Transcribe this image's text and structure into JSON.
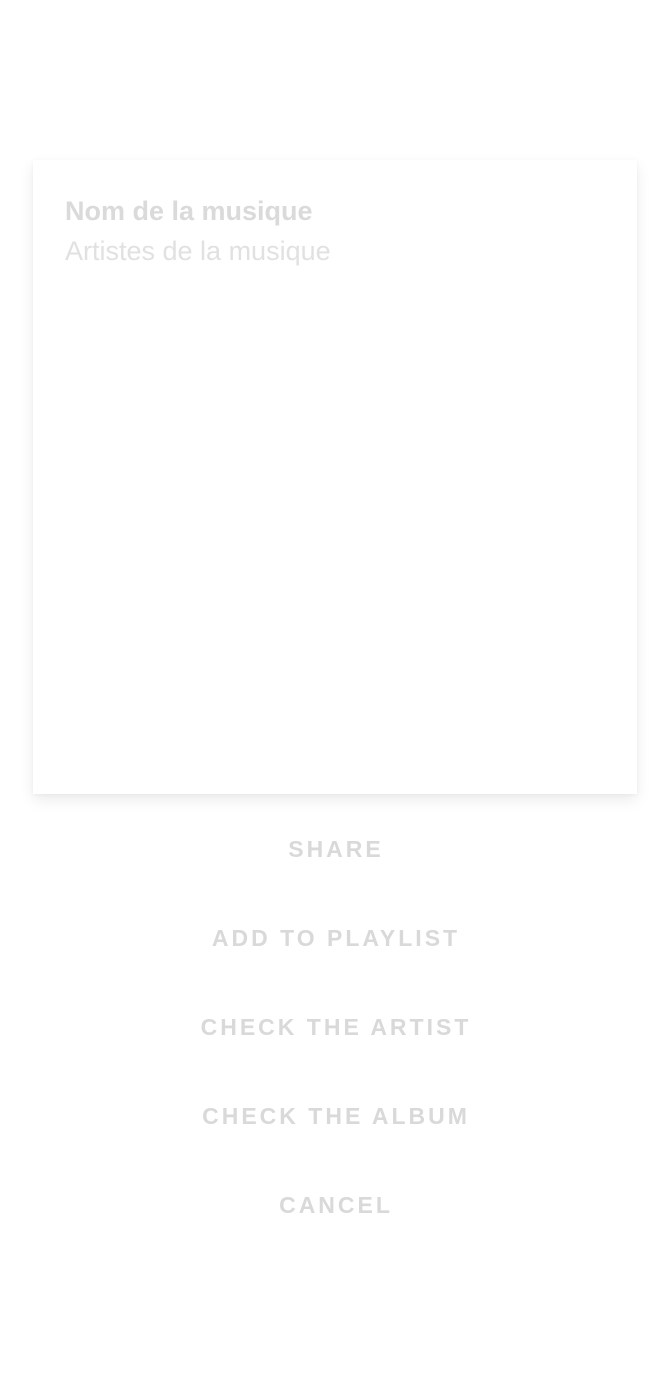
{
  "track": {
    "title": "Nom de la musique",
    "artists": "Artistes de la musique"
  },
  "actions": {
    "share": "SHARE",
    "add_to_playlist": "ADD TO PLAYLIST",
    "check_artist": "CHECK THE ARTIST",
    "check_album": "CHECK THE ALBUM",
    "cancel": "CANCEL"
  }
}
